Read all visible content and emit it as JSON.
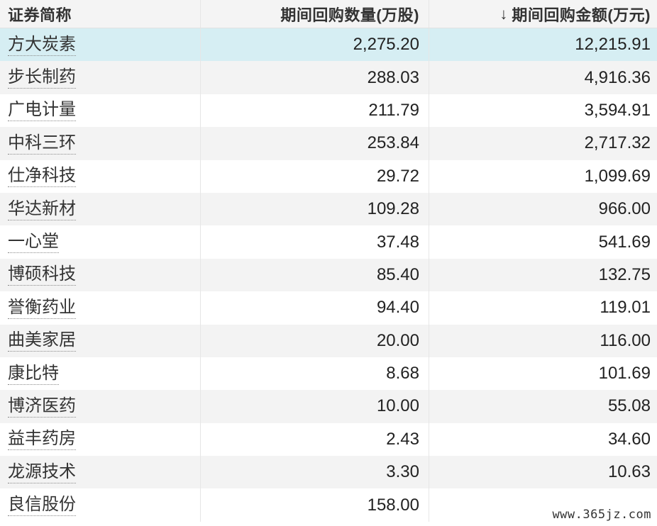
{
  "headers": {
    "name": "证券简称",
    "quantity": "期间回购数量(万股)",
    "amount_arrow": "↓",
    "amount": "期间回购金额(万元)"
  },
  "rows": [
    {
      "name": "方大炭素",
      "quantity": "2,275.20",
      "amount": "12,215.91"
    },
    {
      "name": "步长制药",
      "quantity": "288.03",
      "amount": "4,916.36"
    },
    {
      "name": "广电计量",
      "quantity": "211.79",
      "amount": "3,594.91"
    },
    {
      "name": "中科三环",
      "quantity": "253.84",
      "amount": "2,717.32"
    },
    {
      "name": "仕净科技",
      "quantity": "29.72",
      "amount": "1,099.69"
    },
    {
      "name": "华达新材",
      "quantity": "109.28",
      "amount": "966.00"
    },
    {
      "name": "一心堂",
      "quantity": "37.48",
      "amount": "541.69"
    },
    {
      "name": "博硕科技",
      "quantity": "85.40",
      "amount": "132.75"
    },
    {
      "name": "誉衡药业",
      "quantity": "94.40",
      "amount": "119.01"
    },
    {
      "name": "曲美家居",
      "quantity": "20.00",
      "amount": "116.00"
    },
    {
      "name": "康比特",
      "quantity": "8.68",
      "amount": "101.69"
    },
    {
      "name": "博济医药",
      "quantity": "10.00",
      "amount": "55.08"
    },
    {
      "name": "益丰药房",
      "quantity": "2.43",
      "amount": "34.60"
    },
    {
      "name": "龙源技术",
      "quantity": "3.30",
      "amount": "10.63"
    },
    {
      "name": "良信股份",
      "quantity": "158.00",
      "amount": ""
    }
  ],
  "selected_row": 0,
  "watermark": "www.365jz.com",
  "colors": {
    "header_bg": "#f4f4f4",
    "stripe_bg": "#f3f3f3",
    "selected_bg": "#d6eef3",
    "text": "#333333"
  }
}
